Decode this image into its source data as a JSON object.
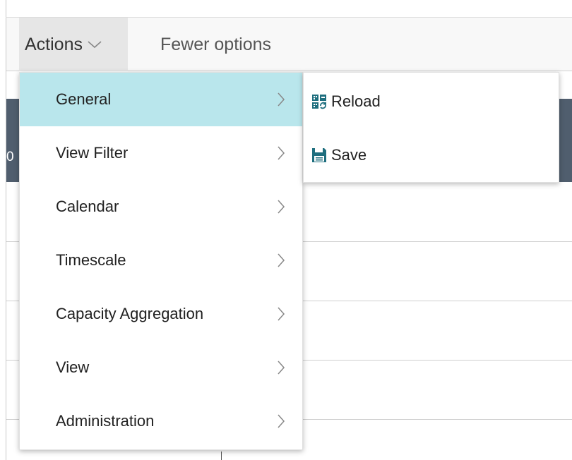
{
  "toolbar": {
    "actions_label": "Actions",
    "fewer_label": "Fewer options"
  },
  "background": {
    "band_text": "0"
  },
  "menu": {
    "items": [
      {
        "label": "General"
      },
      {
        "label": "View Filter"
      },
      {
        "label": "Calendar"
      },
      {
        "label": "Timescale"
      },
      {
        "label": "Capacity Aggregation"
      },
      {
        "label": "View"
      },
      {
        "label": "Administration"
      }
    ]
  },
  "submenu": {
    "items": [
      {
        "label": "Reload",
        "icon": "reload-icon"
      },
      {
        "label": "Save",
        "icon": "save-icon"
      }
    ]
  },
  "colors": {
    "highlight": "#b9e6ec",
    "icon_teal": "#1e6e7e",
    "band": "#505e6e"
  }
}
